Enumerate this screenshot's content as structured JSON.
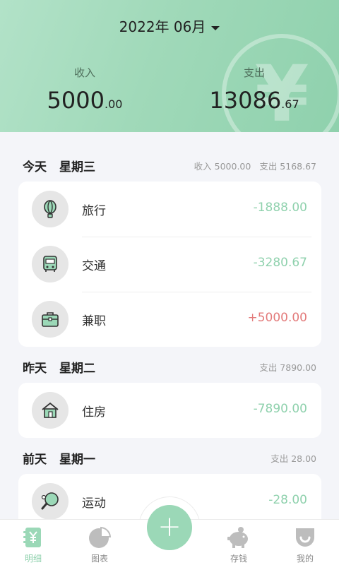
{
  "header": {
    "month": "2022年 06月",
    "income_label": "收入",
    "income_int": "5000",
    "income_dec": ".00",
    "expense_label": "支出",
    "expense_int": "13086",
    "expense_dec": ".67",
    "watermark": "¥"
  },
  "days": [
    {
      "title": "今天",
      "weekday": "星期三",
      "income_summary": "收入 5000.00",
      "expense_summary": "支出 5168.67",
      "items": [
        {
          "name": "旅行",
          "amount": "-1888.00",
          "icon": "balloon-icon"
        },
        {
          "name": "交通",
          "amount": "-3280.67",
          "icon": "bus-icon"
        },
        {
          "name": "兼职",
          "amount": "+5000.00",
          "icon": "briefcase-icon"
        }
      ]
    },
    {
      "title": "昨天",
      "weekday": "星期二",
      "expense_summary": "支出 7890.00",
      "items": [
        {
          "name": "住房",
          "amount": "-7890.00",
          "icon": "house-icon"
        }
      ]
    },
    {
      "title": "前天",
      "weekday": "星期一",
      "expense_summary": "支出 28.00",
      "items": [
        {
          "name": "运动",
          "amount": "-28.00",
          "icon": "ping-pong-icon"
        }
      ]
    }
  ],
  "tabs": [
    {
      "label": "明细",
      "icon": "ledger-icon",
      "active": true
    },
    {
      "label": "图表",
      "icon": "pie-chart-icon"
    },
    {
      "label": "存钱",
      "icon": "piggy-bank-icon"
    },
    {
      "label": "我的",
      "icon": "profile-icon"
    }
  ],
  "fab": {
    "label": "+",
    "icon": "plus-icon"
  },
  "colors": {
    "accent": "#8fd1ad",
    "income": "#e37b7b",
    "header_bg": "#a0d9b9"
  }
}
